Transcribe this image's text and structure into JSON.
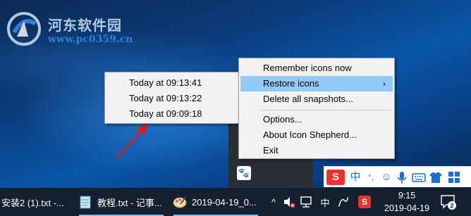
{
  "watermark": {
    "cn": "河东软件园",
    "url": "www.pc0359.cn"
  },
  "main_menu": {
    "items": [
      {
        "label": "Remember icons now",
        "submenu": false,
        "highlighted": false
      },
      {
        "label": "Restore icons",
        "submenu": true,
        "highlighted": true
      },
      {
        "label": "Delete all snapshots...",
        "submenu": false,
        "highlighted": false
      },
      {
        "label": "Options...",
        "submenu": false,
        "highlighted": false
      },
      {
        "label": "About Icon Shepherd...",
        "submenu": false,
        "highlighted": false
      },
      {
        "label": "Exit",
        "submenu": false,
        "highlighted": false
      }
    ],
    "submenu_arrow": "›"
  },
  "sub_menu": {
    "items": [
      {
        "label": "Today at 09:13:41"
      },
      {
        "label": "Today at 09:13:22"
      },
      {
        "label": "Today at 09:09:18"
      }
    ]
  },
  "ime": {
    "logo": "S",
    "lang": "中",
    "punct": "°,",
    "emoji": "☺",
    "mic": "mic-icon",
    "keyboard": "keyboard-icon",
    "skin": "shirt-icon",
    "grid": "grid-icon"
  },
  "taskbar": {
    "tasks": [
      {
        "label": "安装2 (1).txt -...",
        "icon": "notepad-icon"
      },
      {
        "label": "教程.txt - 记事...",
        "icon": "notepad-icon"
      },
      {
        "label": "2019-04-19_0...",
        "icon": "paint-icon"
      }
    ],
    "tray": {
      "chevron": "^",
      "ime_lang": "中",
      "sogou": "S"
    },
    "clock": {
      "time": "9:15",
      "date": "2019-04-19"
    },
    "notification_count": "2"
  },
  "colors": {
    "menu_highlight": "#91c9f7",
    "taskbar": "#15202e",
    "arrow_red": "#e0191b",
    "sogou_red": "#e8342b"
  }
}
